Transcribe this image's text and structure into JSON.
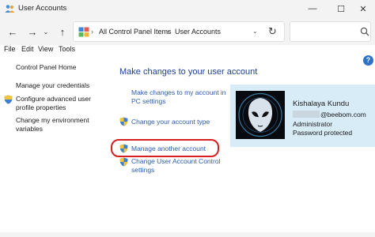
{
  "window": {
    "title": "User Accounts",
    "minimize_glyph": "—",
    "maximize_glyph": "☐",
    "close_glyph": "✕"
  },
  "navigation": {
    "back_glyph": "←",
    "forward_glyph": "→",
    "history_glyph": "⌄",
    "up_glyph": "↑",
    "breadcrumb": [
      "All Control Panel Items",
      "User Accounts"
    ],
    "separator": "›",
    "refresh_glyph": "↻",
    "search_placeholder": ""
  },
  "menu": {
    "file": "File",
    "edit": "Edit",
    "view": "View",
    "tools": "Tools"
  },
  "left_pane": {
    "home": "Control Panel Home",
    "credentials": "Manage your credentials",
    "advanced": "Configure advanced user profile properties",
    "environment": "Change my environment variables"
  },
  "main": {
    "title": "Make changes to your user account",
    "links": {
      "pc_settings": "Make changes to my account in PC settings",
      "account_type": "Change your account type",
      "manage_other": "Manage another account",
      "uac": "Change User Account Control settings"
    }
  },
  "account": {
    "name": "Kishalaya Kundu",
    "email_domain": "@beebom.com",
    "role": "Administrator",
    "password_status": "Password protected"
  },
  "help_glyph": "?",
  "colors": {
    "link": "#2a5daf",
    "heading": "#1c3f94",
    "highlight": "#d42020",
    "card_bg": "#d8ecf8"
  }
}
